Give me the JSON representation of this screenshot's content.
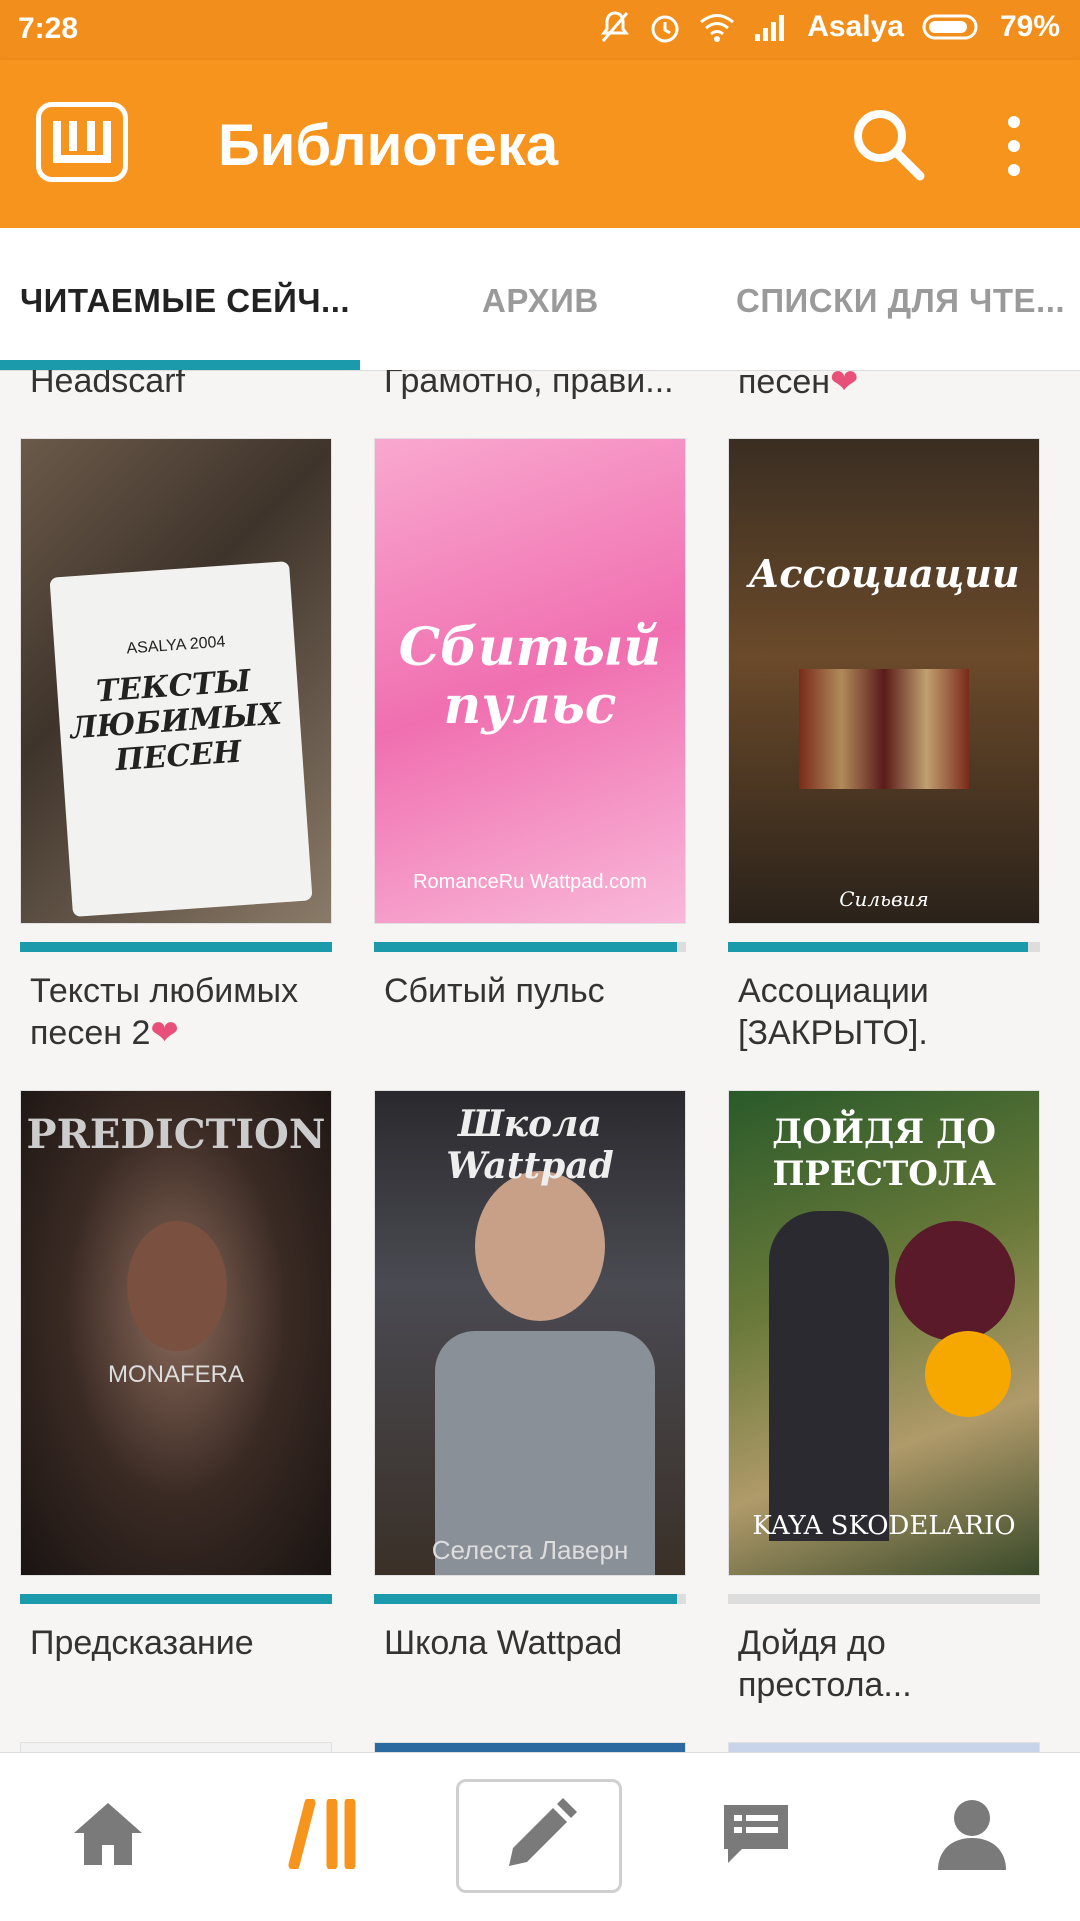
{
  "status_bar": {
    "time": "7:28",
    "carrier": "Asalya",
    "battery": "79%"
  },
  "app_bar": {
    "title": "Библиотека",
    "logo_icon": "wattpad-logo-icon",
    "search_icon": "search-icon",
    "more_icon": "more-vert-icon"
  },
  "tabs": [
    {
      "label": "ЧИТАЕМЫЕ СЕЙЧ...",
      "active": true
    },
    {
      "label": "АРХИВ",
      "active": false
    },
    {
      "label": "СПИСКИ ДЛЯ ЧТЕ...",
      "active": false
    }
  ],
  "partial_titles": [
    "Headscarf",
    "Грамотно, прави...",
    "песен"
  ],
  "stories": [
    {
      "title": "Тексты любимых песен 2",
      "heart": true,
      "cover_text": "ТЕКСТЫ ЛЮБИМЫХ ПЕСЕН",
      "cover_sub": "ASALYA 2004",
      "progress": 1.0
    },
    {
      "title": "Сбитый пульс",
      "heart": false,
      "cover_text": "Сбитый пульс",
      "cover_sub": "RomanceRu  Wattpad.com",
      "progress": 0.97
    },
    {
      "title": "Ассоциации [ЗАКРЫТО].",
      "heart": false,
      "cover_text": "Ассоциации",
      "cover_sub": "Сильвия",
      "progress": 0.96
    },
    {
      "title": "Предсказание",
      "heart": false,
      "cover_text": "PREDICTION",
      "cover_sub": "MONAFERA",
      "progress": 1.0
    },
    {
      "title": "Школа Wattpad",
      "heart": false,
      "cover_text": "Школа Wattpad",
      "cover_sub": "Селеста Лаверн",
      "progress": 0.97
    },
    {
      "title": "Дойдя до престола...",
      "heart": false,
      "cover_text": "ДОЙДЯ ДО ПРЕСТОЛА",
      "cover_sub": "KAYA SKODELARIO",
      "progress": 0.0
    }
  ],
  "bottom_nav": {
    "home_icon": "home-icon",
    "library_icon": "library-icon",
    "write_icon": "pencil-icon",
    "messages_icon": "message-icon",
    "profile_icon": "profile-icon"
  },
  "colors": {
    "accent": "#f7941d",
    "progress": "#1a9aaa",
    "heart": "#e8507a"
  }
}
